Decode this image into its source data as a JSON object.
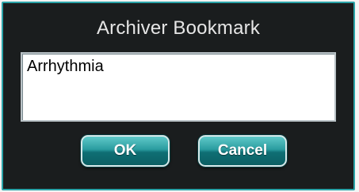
{
  "dialog": {
    "title": "Archiver Bookmark",
    "input_value": "Arrhythmia",
    "buttons": {
      "ok_label": "OK",
      "cancel_label": "Cancel"
    }
  },
  "colors": {
    "dialog_bg": "#1a1d1e",
    "dialog_border": "#2aa3a8",
    "button_teal": "#2a9c9f",
    "title_text": "#e6e6e6"
  }
}
